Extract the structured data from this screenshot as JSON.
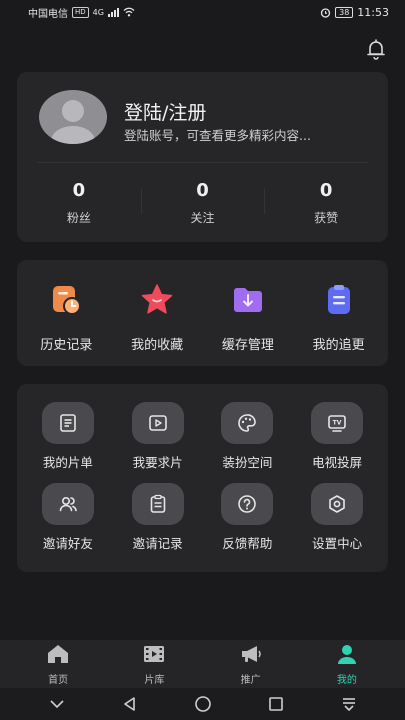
{
  "status_bar": {
    "carrier": "中国电信",
    "hd": "HD",
    "net": "4G",
    "battery": "38",
    "time": "11:53"
  },
  "profile": {
    "title": "登陆/注册",
    "subtitle": "登陆账号，可查看更多精彩内容..."
  },
  "stats": [
    {
      "value": "0",
      "label": "粉丝"
    },
    {
      "value": "0",
      "label": "关注"
    },
    {
      "value": "0",
      "label": "获赞"
    }
  ],
  "quick_actions": [
    {
      "label": "历史记录",
      "icon": "history-icon",
      "color": "#f08a4b"
    },
    {
      "label": "我的收藏",
      "icon": "star-icon",
      "color": "#ef4b5c"
    },
    {
      "label": "缓存管理",
      "icon": "download-folder-icon",
      "color": "#a06cf0"
    },
    {
      "label": "我的追更",
      "icon": "clipboard-icon",
      "color": "#5d6cf2"
    }
  ],
  "tools": [
    {
      "label": "我的片单",
      "icon": "list-icon"
    },
    {
      "label": "我要求片",
      "icon": "play-icon"
    },
    {
      "label": "装扮空间",
      "icon": "palette-icon"
    },
    {
      "label": "电视投屏",
      "icon": "tv-icon"
    },
    {
      "label": "邀请好友",
      "icon": "users-icon"
    },
    {
      "label": "邀请记录",
      "icon": "record-icon"
    },
    {
      "label": "反馈帮助",
      "icon": "help-icon"
    },
    {
      "label": "设置中心",
      "icon": "settings-icon"
    }
  ],
  "tabs": [
    {
      "label": "首页",
      "icon": "home-icon"
    },
    {
      "label": "片库",
      "icon": "film-icon"
    },
    {
      "label": "推广",
      "icon": "megaphone-icon"
    },
    {
      "label": "我的",
      "icon": "profile-icon",
      "active": true
    }
  ],
  "colors": {
    "accent": "#2fd3b4",
    "card": "#262629",
    "background": "#1a1a1c"
  }
}
